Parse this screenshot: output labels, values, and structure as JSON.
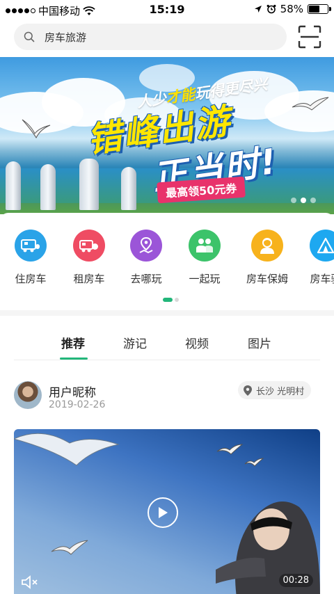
{
  "status_bar": {
    "carrier": "中国移动",
    "time": "15:19",
    "battery": "58%",
    "battery_level": 0.58
  },
  "search": {
    "placeholder": "房车旅游"
  },
  "banner": {
    "slogan_part1": "人少",
    "slogan_highlight": "才能",
    "slogan_part2": "玩得更尽兴",
    "headline_1": "错峰出游",
    "headline_2": "正当时!",
    "coupon": "最高领50元券",
    "page_count": 3,
    "active_page": 2
  },
  "categories": [
    {
      "label": "住房车",
      "color": "#2aa3e8",
      "icon": "rv-stay-icon"
    },
    {
      "label": "租房车",
      "color": "#ef4c63",
      "icon": "rv-rent-icon"
    },
    {
      "label": "去哪玩",
      "color": "#9b55d8",
      "icon": "route-map-icon"
    },
    {
      "label": "一起玩",
      "color": "#3cc36a",
      "icon": "group-people-icon"
    },
    {
      "label": "房车保姆",
      "color": "#f7b21c",
      "icon": "nanny-icon"
    },
    {
      "label": "房车驿",
      "color": "#1ea8f0",
      "icon": "camp-tent-icon"
    }
  ],
  "category_pager": {
    "pages": 2,
    "active": 1
  },
  "tabs": [
    {
      "label": "推荐",
      "active": true
    },
    {
      "label": "游记",
      "active": false
    },
    {
      "label": "视频",
      "active": false
    },
    {
      "label": "图片",
      "active": false
    }
  ],
  "post": {
    "user_name": "用户昵称",
    "date": "2019-02-26",
    "location": "长沙 光明村",
    "duration": "00:28"
  },
  "colors": {
    "accent": "#22b67a",
    "coupon": "#e8326b"
  }
}
